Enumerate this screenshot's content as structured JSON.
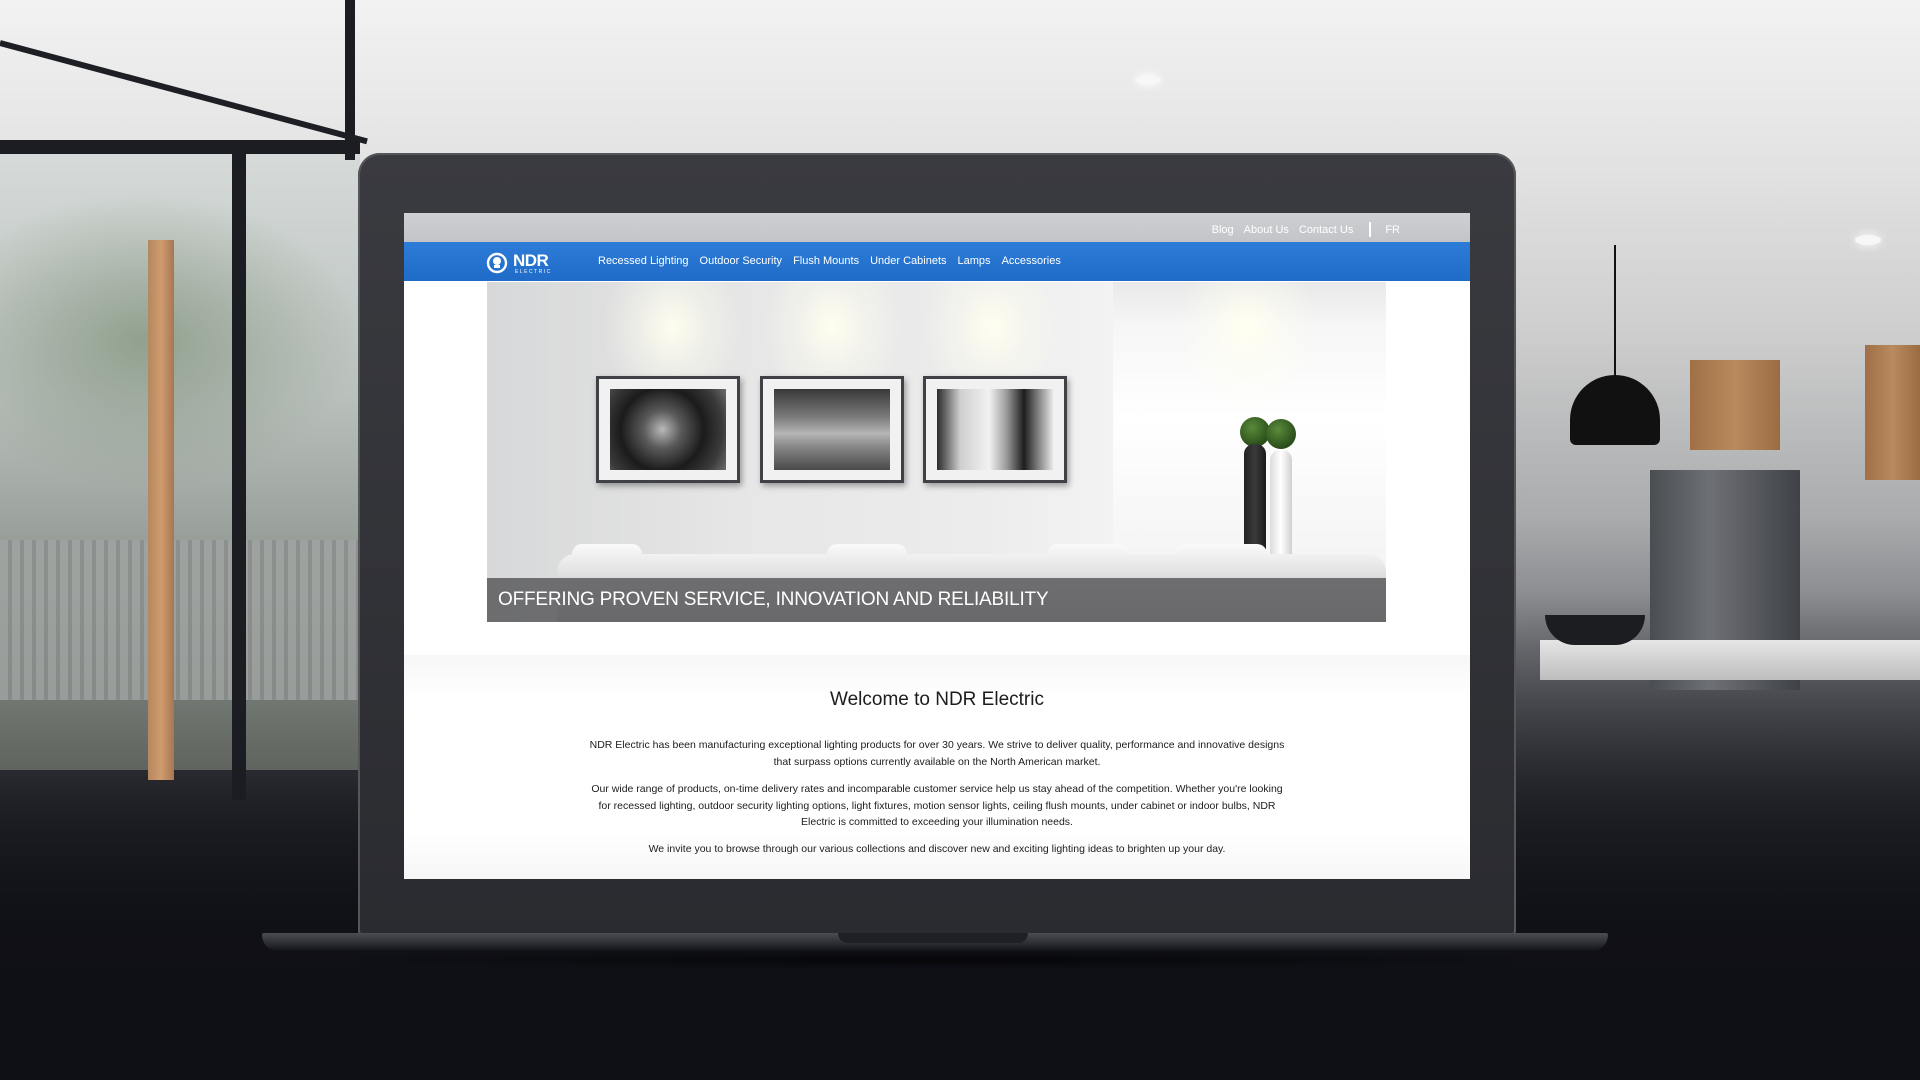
{
  "top_links": {
    "blog": "Blog",
    "about": "About Us",
    "contact": "Contact Us",
    "lang": "FR"
  },
  "brand": {
    "name": "NDR",
    "sub": "ELECTRIC",
    "color": "#2272cf"
  },
  "nav": {
    "items": [
      "Recessed Lighting",
      "Outdoor Security",
      "Flush Mounts",
      "Under Cabinets",
      "Lamps",
      "Accessories"
    ]
  },
  "hero": {
    "caption": "OFFERING PROVEN SERVICE, INNOVATION AND RELIABILITY"
  },
  "welcome": {
    "title": "Welcome to NDR Electric",
    "p1": "NDR Electric has been manufacturing exceptional lighting products for over 30 years. We strive to deliver quality, performance and innovative designs that surpass options currently available on the North American market.",
    "p2": "Our wide range of products, on-time delivery rates and incomparable customer service help us stay ahead of the competition. Whether you're looking for recessed lighting, outdoor security lighting options, light fixtures, motion sensor lights, ceiling flush mounts, under cabinet or indoor bulbs, NDR Electric is committed to exceeding your illumination needs.",
    "p3": "We invite you to browse through our various collections and discover new and exciting lighting ideas to brighten up your day."
  }
}
